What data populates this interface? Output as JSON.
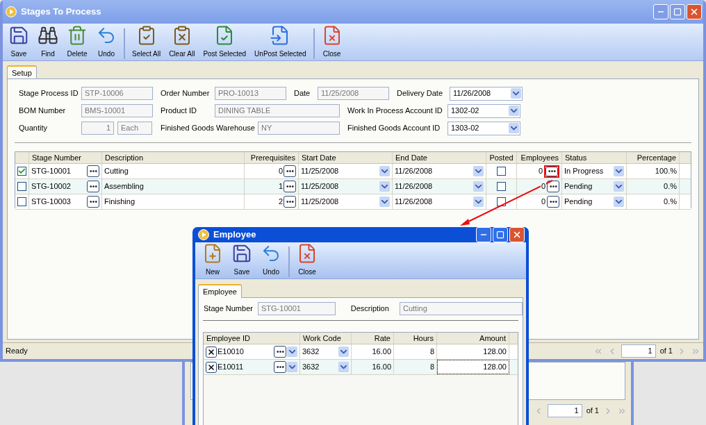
{
  "main_window": {
    "title": "Stages To Process",
    "toolbar": [
      {
        "label": "Save",
        "kind": "save",
        "separator_before": false
      },
      {
        "label": "Find",
        "kind": "find",
        "separator_before": false
      },
      {
        "label": "Delete",
        "kind": "delete",
        "separator_before": false
      },
      {
        "label": "Undo",
        "kind": "undo",
        "separator_before": false
      },
      {
        "label": "Select All",
        "kind": "select_all",
        "separator_before": true
      },
      {
        "label": "Clear All",
        "kind": "clear_all",
        "separator_before": false
      },
      {
        "label": "Post Selected",
        "kind": "post",
        "separator_before": false
      },
      {
        "label": "UnPost Selected",
        "kind": "unpost",
        "separator_before": false
      },
      {
        "label": "Close",
        "kind": "close",
        "separator_before": true
      }
    ],
    "tabs": [
      {
        "label": "Setup",
        "selected": true
      }
    ],
    "form_rows": [
      [
        {
          "label": "Stage Process ID",
          "value": "STP-10006",
          "kind": "text"
        },
        {
          "label": "Order Number",
          "value": "PRO-10013",
          "kind": "text"
        },
        {
          "label": "Date",
          "value": "11/25/2008",
          "kind": "text"
        },
        {
          "label": "Delivery Date",
          "value": "11/26/2008",
          "kind": "dropdown"
        }
      ],
      [
        {
          "label": "BOM Number",
          "value": "BMS-10001",
          "kind": "text"
        },
        {
          "label": "Product ID",
          "value": "DINING TABLE",
          "kind": "wide"
        },
        {
          "label": "Work In Process Account ID",
          "value": "1302-02",
          "kind": "dropdown"
        }
      ],
      [
        {
          "label": "Quantity",
          "value": "1",
          "unit": "Each",
          "kind": "quantity"
        },
        {
          "label": "Finished Goods Warehouse",
          "value": "NY",
          "kind": "short"
        },
        {
          "label": "Finished Goods Account ID",
          "value": "1303-02",
          "kind": "dropdown"
        }
      ]
    ],
    "grid": {
      "columns": [
        "Stage Number",
        "Description",
        "Prerequisites",
        "Start Date",
        "End Date",
        "Posted",
        "Employees",
        "Status",
        "Percentage"
      ],
      "rows": [
        {
          "checked": true,
          "stage_number": "STG-10001",
          "description": "Cutting",
          "prerequisites": "0",
          "start_date": "11/25/2008",
          "end_date": "11/26/2008",
          "posted": false,
          "employees": "0",
          "highlighted": true,
          "status": "In Progress",
          "percentage": "100.%"
        },
        {
          "checked": false,
          "stage_number": "STG-10002",
          "description": "Assembling",
          "prerequisites": "1",
          "start_date": "11/25/2008",
          "end_date": "11/26/2008",
          "posted": false,
          "employees": "0",
          "highlighted": false,
          "status": "Pending",
          "percentage": "0.%"
        },
        {
          "checked": false,
          "stage_number": "STG-10003",
          "description": "Finishing",
          "prerequisites": "2",
          "start_date": "11/25/2008",
          "end_date": "11/26/2008",
          "posted": false,
          "employees": "0",
          "highlighted": false,
          "status": "Pending",
          "percentage": "0.%"
        }
      ]
    },
    "status_bar": {
      "text": "Ready",
      "page": "1",
      "page_count": "of 1"
    }
  },
  "background_window": {
    "page": "1",
    "page_count": "of 1"
  },
  "employee_window": {
    "title": "Employee",
    "toolbar": [
      {
        "label": "New",
        "kind": "new",
        "separator_before": false
      },
      {
        "label": "Save",
        "kind": "save",
        "separator_before": false
      },
      {
        "label": "Undo",
        "kind": "undo",
        "separator_before": false
      },
      {
        "label": "Close",
        "kind": "close",
        "separator_before": true
      }
    ],
    "tabs": [
      {
        "label": "Employee",
        "selected": true
      }
    ],
    "fields": [
      {
        "label": "Stage Number",
        "value": "STG-10001"
      },
      {
        "label": "Description",
        "value": "Cutting"
      }
    ],
    "grid": {
      "columns": [
        "Employee ID",
        "Work Code",
        "Rate",
        "Hours",
        "Amount"
      ],
      "rows": [
        {
          "employee_id": "E10010",
          "work_code": "3632",
          "rate": "16.00",
          "hours": "8",
          "amount": "128.00",
          "focused": false
        },
        {
          "employee_id": "E10011",
          "work_code": "3632",
          "rate": "16.00",
          "hours": "8",
          "amount": "128.00",
          "focused": true
        }
      ]
    }
  }
}
